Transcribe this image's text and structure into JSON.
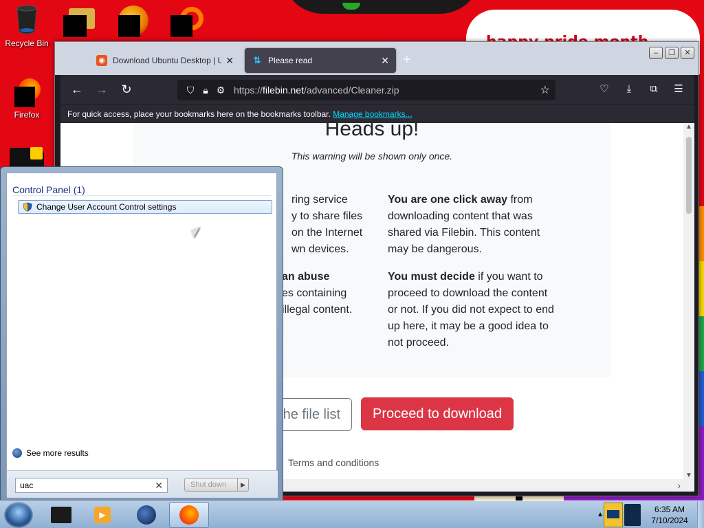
{
  "desktop": {
    "banner_text": "happy pride month",
    "icons": [
      {
        "label": "Recycle Bin"
      },
      {
        "label": "Firefox"
      }
    ]
  },
  "browser": {
    "tabs": [
      {
        "title": "Download Ubuntu Desktop | Ubuntu",
        "active": false
      },
      {
        "title": "Please read",
        "active": true
      }
    ],
    "new_tab": "+",
    "window_controls": {
      "minimize": "–",
      "maximize": "❐",
      "close": "✕"
    },
    "url": {
      "prefix": "https://",
      "host": "filebin.net",
      "path": "/advanced/Cleaner.zip"
    },
    "bookmarks_bar": {
      "text": "For quick access, place your bookmarks here on the bookmarks toolbar.",
      "link": "Manage bookmarks..."
    },
    "page": {
      "heading": "Heads up!",
      "subheading": "This warning will be shown only once.",
      "left_col": {
        "p1_tail": "ring service\ny to share files\non the Internet\nwn devices.",
        "p2_bold": "an abuse",
        "p2_tail": "es containing\nillegal content."
      },
      "right_col": {
        "p1_bold": "You are one click away",
        "p1_rest": " from downloading content that was shared via Filebin. This content may be dangerous.",
        "p2_bold": "You must decide",
        "p2_rest": " if you want to proceed to download the content or not. If you did not expect to end up here, it may be a good idea to not proceed."
      },
      "btn_file_list": "he file list",
      "btn_download": "Proceed to download",
      "terms": "Terms and conditions"
    }
  },
  "start_menu": {
    "category": "Control Panel (1)",
    "result": "Change User Account Control settings",
    "see_more": "See more results",
    "search_value": "uac",
    "clear": "✕",
    "shutdown_label": "Shut down",
    "shutdown_arrow": "▶"
  },
  "taskbar": {
    "time": "6:35 AM",
    "date": "7/10/2024"
  },
  "colors": {
    "desktop_red": "#e30613",
    "download_button": "#dc3545",
    "firefox_dark": "#2b2a33",
    "link_cyan": "#00ddff"
  }
}
